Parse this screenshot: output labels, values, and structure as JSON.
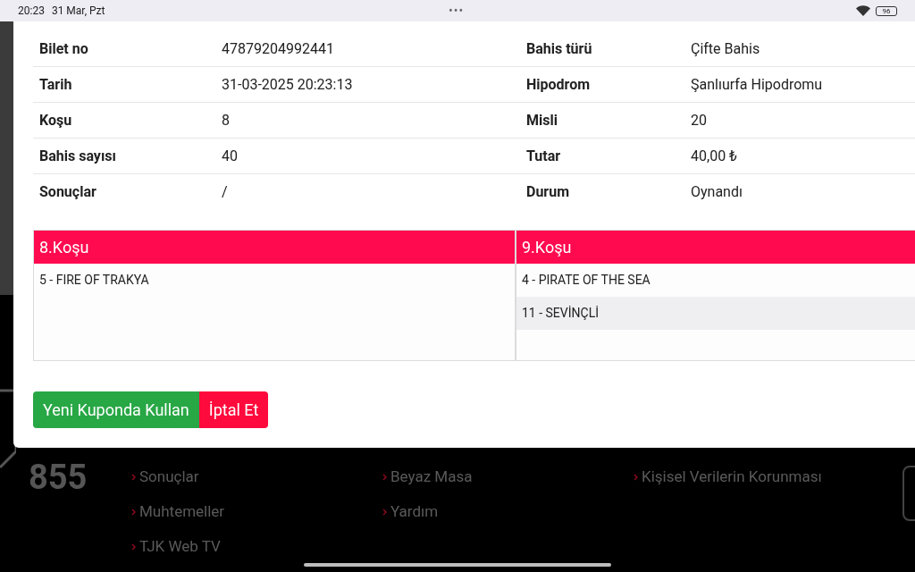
{
  "status_bar": {
    "time": "20:23",
    "date": "31 Mar, Pzt",
    "menu": "•••",
    "battery": "96"
  },
  "details": [
    {
      "label": "Bilet no",
      "value": "47879204992441",
      "label_2": "Bahis türü",
      "value_2": "Çifte Bahis"
    },
    {
      "label": "Tarih",
      "value": "31-03-2025 20:23:13",
      "label_2": "Hipodrom",
      "value_2": "Şanlıurfa Hipodromu"
    },
    {
      "label": "Koşu",
      "value": "8",
      "label_2": "Misli",
      "value_2": "20"
    },
    {
      "label": "Bahis sayısı",
      "value": "40",
      "label_2": "Tutar",
      "value_2": "40,00 ₺"
    },
    {
      "label": "Sonuçlar",
      "value": "/",
      "label_2": "Durum",
      "value_2": "Oynandı"
    }
  ],
  "races": [
    {
      "title": "8.Koşu",
      "horses": [
        "5 - FIRE OF TRAKYA"
      ]
    },
    {
      "title": "9.Koşu",
      "horses": [
        "4 - PIRATE OF THE SEA",
        "11 - SEVİNÇLİ"
      ]
    }
  ],
  "buttons": [
    {
      "label": "Yeni Kuponda Kullan",
      "kind": "success"
    },
    {
      "label": "İptal Et",
      "kind": "danger"
    }
  ],
  "footer": {
    "logo_number": "855",
    "columns": [
      [
        "Sonuçlar",
        "Muhtemeller",
        "TJK Web TV"
      ],
      [
        "Beyaz Masa",
        "Yardım"
      ],
      [
        "Kişisel Verilerin Korunması"
      ]
    ]
  }
}
